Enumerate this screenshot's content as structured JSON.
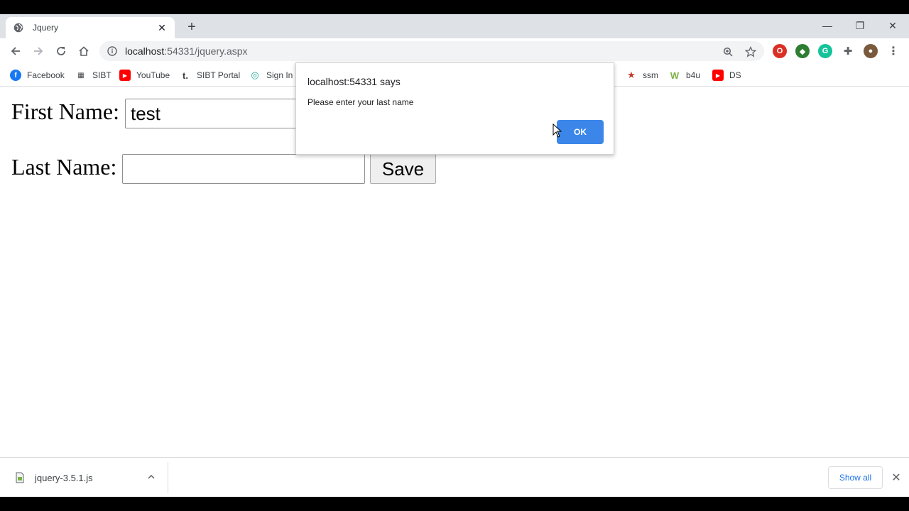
{
  "tab": {
    "title": "Jquery",
    "favicon": "globe-icon",
    "close": "✕"
  },
  "newtab": "+",
  "window_controls": {
    "minimize": "—",
    "restore": "❐",
    "close": "✕"
  },
  "toolbar": {
    "url_host": "localhost",
    "url_rest": ":54331/jquery.aspx"
  },
  "bookmarks": [
    {
      "label": "Facebook",
      "icon": "facebook-icon",
      "color": "#1877f2"
    },
    {
      "label": "SIBT",
      "icon": "sibt-icon",
      "color": "#3c4043"
    },
    {
      "label": "YouTube",
      "icon": "youtube-icon",
      "color": "#ff0000"
    },
    {
      "label": "SIBT Portal",
      "icon": "t-icon",
      "color": "#3c4043"
    },
    {
      "label": "Sign In",
      "icon": "sign-in-icon",
      "color": "#26a69a"
    },
    {
      "label": "ssm",
      "icon": "ssm-icon",
      "color": "#c0392b"
    },
    {
      "label": "b4u",
      "icon": "w-icon",
      "color": "#7cb342"
    },
    {
      "label": "DS",
      "icon": "youtube-icon",
      "color": "#ff0000"
    }
  ],
  "form": {
    "first_name_label": "First Name:",
    "first_name_value": "test",
    "last_name_label": "Last Name:",
    "last_name_value": "",
    "save_label": "Save"
  },
  "alert": {
    "title": "localhost:54331 says",
    "message": "Please enter your last name",
    "ok_label": "OK",
    "ok_color": "#3b86e8"
  },
  "download": {
    "file_name": "jquery-3.5.1.js",
    "show_all": "Show all"
  }
}
